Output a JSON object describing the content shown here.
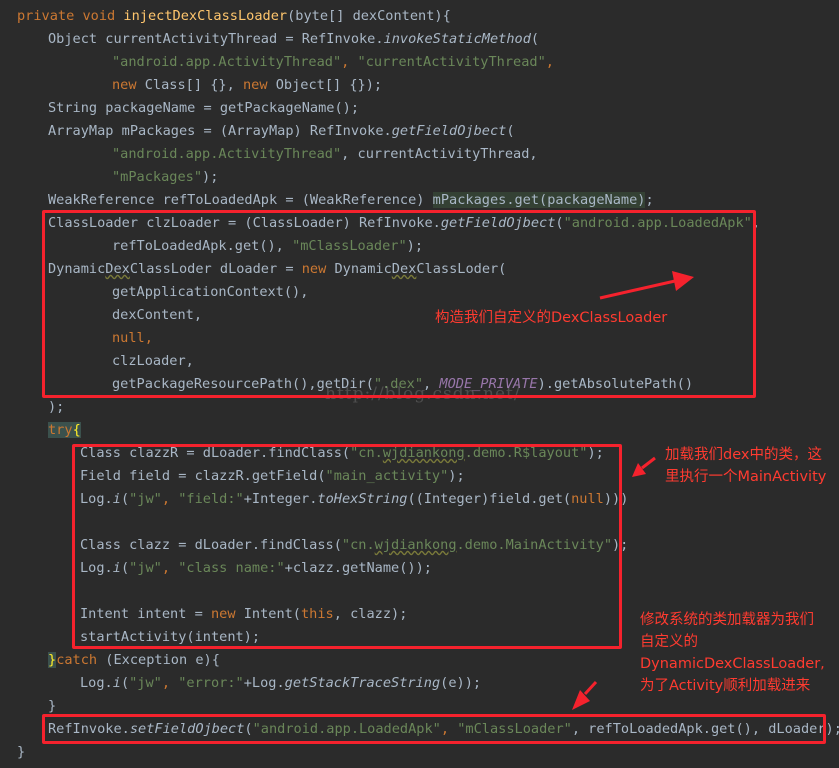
{
  "code": {
    "l1": {
      "a": "private void ",
      "b": "injectDexClassLoader",
      "c": "(byte[] dexContent){"
    },
    "l2": {
      "a": "Object currentActivityThread = RefInvoke.",
      "b": "invokeStaticMethod",
      "c": "("
    },
    "l3": {
      "a": "\"android.app.ActivityThread\"",
      "b": ", ",
      "c": "\"currentActivityThread\"",
      "d": ","
    },
    "l4": {
      "a": "new ",
      "b": "Class[] {}, ",
      "c": "new ",
      "d": "Object[] {});"
    },
    "l5": {
      "a": "String packageName = getPackageName();"
    },
    "l6": {
      "a": "ArrayMap mPackages = (ArrayMap) RefInvoke.",
      "b": "getFieldOjbect",
      "c": "("
    },
    "l7": {
      "a": "\"android.app.ActivityThread\"",
      "b": ", currentActivityThread,"
    },
    "l8": {
      "a": "\"mPackages\"",
      "b": ");"
    },
    "l9": {
      "a": "WeakReference refToLoadedApk = (WeakReference) ",
      "b": "mPackages.get(packageName)",
      "c": ";"
    },
    "l10": {
      "a": "ClassLoader clzLoader = (ClassLoader) RefInvoke.",
      "b": "getFieldOjbect",
      "c": "(",
      "d": "\"android.app.LoadedApk\"",
      "e": ","
    },
    "l11": {
      "a": "refToLoadedApk.get(), ",
      "b": "\"mClassLoader\"",
      "c": ");"
    },
    "l12": {
      "a": "Dynamic",
      "b": "Dex",
      "c": "ClassLoder dLoader = ",
      "d": "new ",
      "e": "Dynamic",
      "f": "Dex",
      "g": "ClassLoder("
    },
    "l13": {
      "a": "getApplicationContext(),"
    },
    "l14": {
      "a": "dexContent,"
    },
    "l15": {
      "a": "null",
      "b": ","
    },
    "l16": {
      "a": "clzLoader,"
    },
    "l17": {
      "a": "getPackageResourcePath(),getDir(",
      "b": "\".dex\"",
      "c": ", ",
      "d": "MODE_PRIVATE",
      "e": ").getAbsolutePath()"
    },
    "l18": {
      "a": ");"
    },
    "l19": {
      "a": "try",
      "b": "{"
    },
    "l20": {
      "a": "Class clazzR = dLoader.findClass(",
      "b": "\"cn.",
      "c": "wjdiankong",
      "d": ".demo.R$layout\"",
      "e": ");"
    },
    "l21": {
      "a": "Field field = clazzR.getField(",
      "b": "\"main_activity\"",
      "c": ");"
    },
    "l22": {
      "a": "Log.",
      "b": "i",
      "c": "(",
      "d": "\"jw\"",
      "e": ", ",
      "f": "\"field:\"",
      "g": "+Integer.",
      "h": "toHexString",
      "i": "((Integer)field.get(",
      "j": "null",
      "k": ")))"
    },
    "l23": {
      "a": "Class clazz = dLoader.findClass(",
      "b": "\"cn.",
      "c": "wjdiankong",
      "d": ".demo.MainActivity\"",
      "e": ");"
    },
    "l24": {
      "a": "Log.",
      "b": "i",
      "c": "(",
      "d": "\"jw\"",
      "e": ", ",
      "f": "\"class name:\"",
      "g": "+clazz.getName());"
    },
    "l25": {
      "a": "Intent intent = ",
      "b": "new ",
      "c": "Intent(",
      "d": "this",
      "e": ", clazz);"
    },
    "l26": {
      "a": "startActivity(intent);"
    },
    "l27": {
      "a": "}",
      "b": "catch ",
      "c": "(Exception e){"
    },
    "l28": {
      "a": "Log.",
      "b": "i",
      "c": "(",
      "d": "\"jw\"",
      "e": ", ",
      "f": "\"error:\"",
      "g": "+Log.",
      "h": "getStackTraceString",
      "i": "(e));"
    },
    "l29": {
      "a": "}"
    },
    "l30": {
      "a": "RefInvoke.",
      "b": "setFieldOjbect",
      "c": "(",
      "d": "\"android.app.LoadedApk\"",
      "e": ", ",
      "f": "\"mClassLoader\"",
      "g": ", refToLoadedApk.get(), dLoader);"
    },
    "l31": {
      "a": "}"
    }
  },
  "annotations": {
    "note1": "构造我们自定义的DexClassLoader",
    "note2_line1": "加载我们dex中的类，这",
    "note2_line2": "里执行一个MainActivity",
    "note3_line1": "修改系统的类加载器为我们",
    "note3_line2": "自定义的",
    "note3_line3": "DynamicDexClassLoader,",
    "note3_line4": "为了Activity顺利加载进来"
  },
  "watermark": "http://blog.csdn.net/",
  "colors": {
    "background": "#2b2b2b",
    "default_text": "#a9b7c6",
    "keyword": "#cc7832",
    "string": "#6a8759",
    "annotation_red": "#f5222d"
  }
}
